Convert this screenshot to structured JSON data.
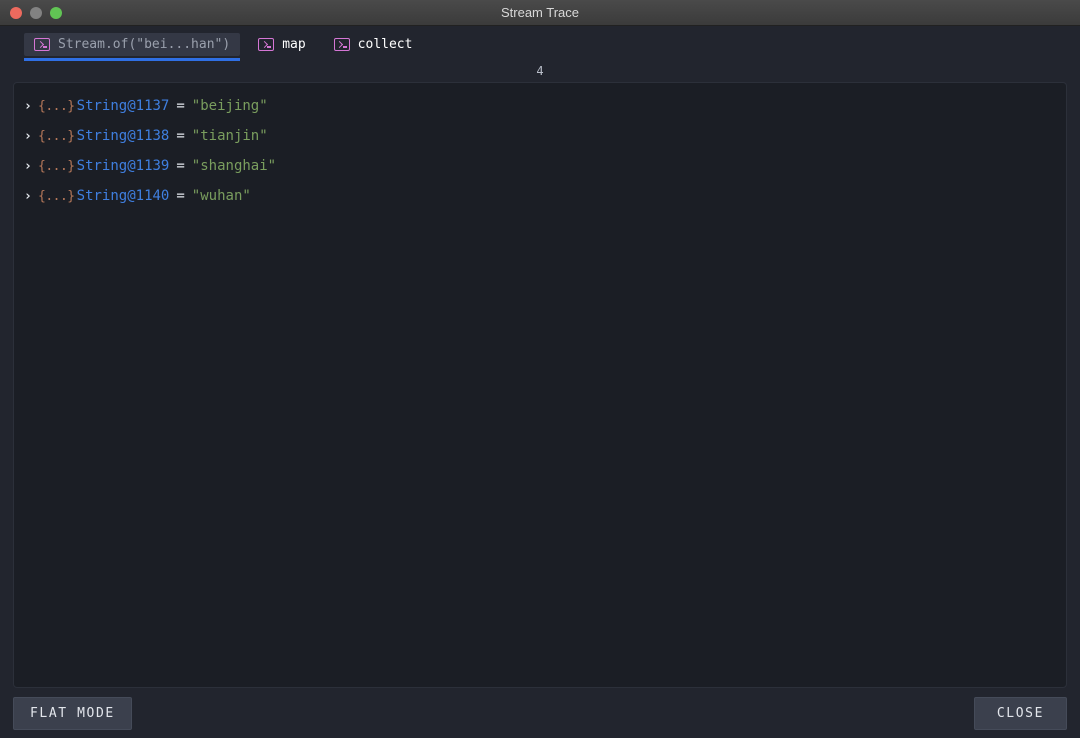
{
  "window": {
    "title": "Stream Trace",
    "traffic_lights": [
      {
        "name": "close",
        "color": "#ed6a5e"
      },
      {
        "name": "minimize",
        "color": "#828282"
      },
      {
        "name": "maximize",
        "color": "#61c454"
      }
    ]
  },
  "tabs": [
    {
      "label": "Stream.of(\"bei...han\")",
      "icon": "terminal-icon",
      "active": true
    },
    {
      "label": "map",
      "icon": "terminal-icon",
      "active": false
    },
    {
      "label": "collect",
      "icon": "terminal-icon",
      "active": false
    }
  ],
  "content": {
    "count": "4",
    "rows": [
      {
        "expander": "›",
        "type_icon": "{...}",
        "ref": "String@1137",
        "eq": "=",
        "value": "\"beijing\""
      },
      {
        "expander": "›",
        "type_icon": "{...}",
        "ref": "String@1138",
        "eq": "=",
        "value": "\"tianjin\""
      },
      {
        "expander": "›",
        "type_icon": "{...}",
        "ref": "String@1139",
        "eq": "=",
        "value": "\"shanghai\""
      },
      {
        "expander": "›",
        "type_icon": "{...}",
        "ref": "String@1140",
        "eq": "=",
        "value": "\"wuhan\""
      }
    ]
  },
  "footer": {
    "flat_mode_label": "FLAT MODE",
    "close_label": "CLOSE"
  },
  "colors": {
    "accent_underline": "#2f6fe4",
    "icon_magenta": "#d576d5",
    "ref_blue": "#3f7fe0",
    "string_green": "#7a9e5e",
    "brace_orange": "#b5785a",
    "window_bg": "#22252e",
    "panel_bg": "#1b1e25"
  }
}
